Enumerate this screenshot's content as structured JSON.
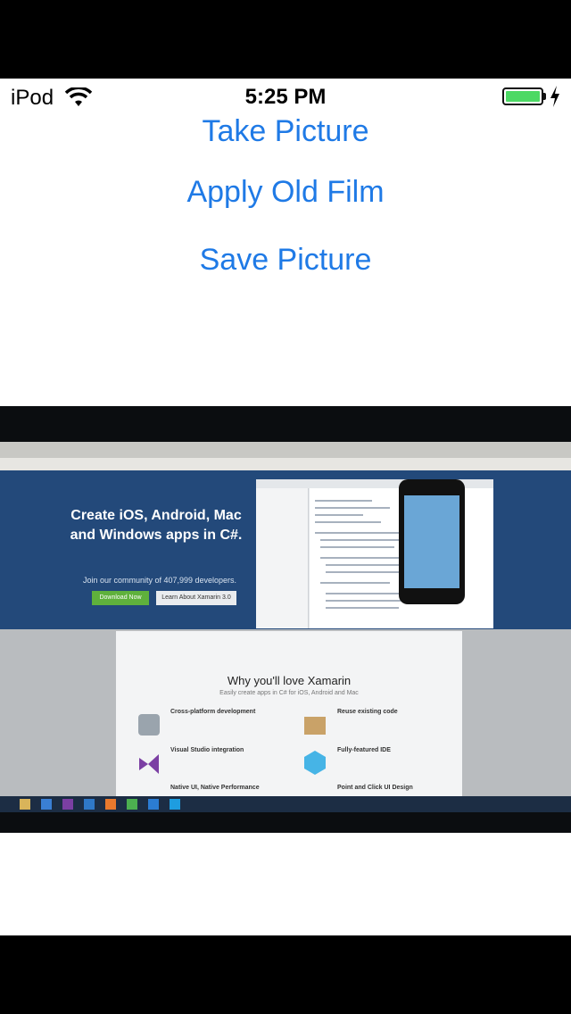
{
  "status_bar": {
    "carrier": "iPod",
    "time": "5:25 PM",
    "battery_level": 1.0,
    "battery_color": "#4cd964"
  },
  "buttons": {
    "take_picture": "Take Picture",
    "apply_old_film": "Apply Old Film",
    "save_picture": "Save Picture"
  },
  "accent_color": "#1f7ae6",
  "photo": {
    "hero_heading": "Create iOS, Android, Mac and Windows apps in C#.",
    "hero_subtext": "Join our community of 407,999 developers.",
    "download_button": "Download Now",
    "learn_button": "Learn About Xamarin 3.0",
    "page_heading": "Why you'll love Xamarin",
    "page_subheading": "Easily create apps in C# for iOS, Android and Mac",
    "features": [
      "Cross-platform development",
      "Reuse existing code",
      "Visual Studio integration",
      "Fully-featured IDE",
      "Native UI, Native Performance",
      "Point and Click UI Design"
    ]
  }
}
